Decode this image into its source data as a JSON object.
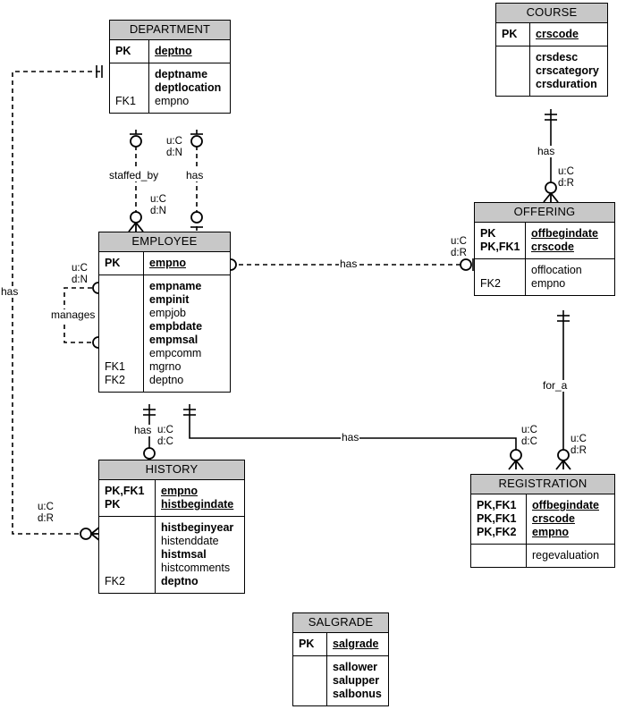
{
  "diagram": {
    "title": "ER Diagram",
    "type": "entity-relationship",
    "accent_header_color": "#c8c8c8",
    "line_color": "#000000"
  },
  "entities": {
    "department": {
      "name": "DEPARTMENT",
      "key_rows": [
        {
          "key": "PK",
          "attr": "deptno",
          "style": "pk"
        }
      ],
      "attr_rows": [
        {
          "key": "",
          "attr": "deptname",
          "style": "bold"
        },
        {
          "key": "",
          "attr": "deptlocation",
          "style": "bold"
        },
        {
          "key": "FK1",
          "attr": "empno",
          "style": "plain"
        }
      ]
    },
    "course": {
      "name": "COURSE",
      "key_rows": [
        {
          "key": "PK",
          "attr": "crscode",
          "style": "pk"
        }
      ],
      "attr_rows": [
        {
          "key": "",
          "attr": "crsdesc",
          "style": "bold"
        },
        {
          "key": "",
          "attr": "crscategory",
          "style": "bold"
        },
        {
          "key": "",
          "attr": "crsduration",
          "style": "bold"
        }
      ]
    },
    "employee": {
      "name": "EMPLOYEE",
      "key_rows": [
        {
          "key": "PK",
          "attr": "empno",
          "style": "pk"
        }
      ],
      "attr_rows": [
        {
          "key": "",
          "attr": "empname",
          "style": "bold"
        },
        {
          "key": "",
          "attr": "empinit",
          "style": "bold"
        },
        {
          "key": "",
          "attr": "empjob",
          "style": "plain"
        },
        {
          "key": "",
          "attr": "empbdate",
          "style": "bold"
        },
        {
          "key": "",
          "attr": "empmsal",
          "style": "bold"
        },
        {
          "key": "",
          "attr": "empcomm",
          "style": "plain"
        },
        {
          "key": "FK1",
          "attr": "mgrno",
          "style": "plain"
        },
        {
          "key": "FK2",
          "attr": "deptno",
          "style": "plain"
        }
      ]
    },
    "offering": {
      "name": "OFFERING",
      "key_rows": [
        {
          "key": "PK",
          "attr": "offbegindate",
          "style": "pk"
        },
        {
          "key": "PK,FK1",
          "attr": "crscode",
          "style": "pk"
        }
      ],
      "attr_rows": [
        {
          "key": "",
          "attr": "offlocation",
          "style": "plain"
        },
        {
          "key": "FK2",
          "attr": "empno",
          "style": "plain"
        }
      ]
    },
    "history": {
      "name": "HISTORY",
      "key_rows": [
        {
          "key": "PK,FK1",
          "attr": "empno",
          "style": "pk"
        },
        {
          "key": "PK",
          "attr": "histbegindate",
          "style": "pk"
        }
      ],
      "attr_rows": [
        {
          "key": "",
          "attr": "histbeginyear",
          "style": "bold"
        },
        {
          "key": "",
          "attr": "histenddate",
          "style": "plain"
        },
        {
          "key": "",
          "attr": "histmsal",
          "style": "bold"
        },
        {
          "key": "",
          "attr": "histcomments",
          "style": "plain"
        },
        {
          "key": "FK2",
          "attr": "deptno",
          "style": "bold"
        }
      ]
    },
    "registration": {
      "name": "REGISTRATION",
      "key_rows": [
        {
          "key": "PK,FK1",
          "attr": "offbegindate",
          "style": "pk"
        },
        {
          "key": "PK,FK1",
          "attr": "crscode",
          "style": "pk"
        },
        {
          "key": "PK,FK2",
          "attr": "empno",
          "style": "pk"
        }
      ],
      "attr_rows": [
        {
          "key": "",
          "attr": "regevaluation",
          "style": "plain"
        }
      ]
    },
    "salgrade": {
      "name": "SALGRADE",
      "key_rows": [
        {
          "key": "PK",
          "attr": "salgrade",
          "style": "pk"
        }
      ],
      "attr_rows": [
        {
          "key": "",
          "attr": "sallower",
          "style": "bold"
        },
        {
          "key": "",
          "attr": "salupper",
          "style": "bold"
        },
        {
          "key": "",
          "attr": "salbonus",
          "style": "bold"
        }
      ]
    }
  },
  "relationships": [
    {
      "id": "dept-emp-staffed-by",
      "label": "staffed_by",
      "from": "DEPARTMENT",
      "to": "EMPLOYEE",
      "line": "dashed",
      "rules": "u:C\nd:N",
      "rule_update": "u:C",
      "rule_delete": "d:N"
    },
    {
      "id": "dept-emp-has",
      "label": "has",
      "from": "DEPARTMENT",
      "to": "EMPLOYEE",
      "line": "dashed",
      "rule_update": "u:C",
      "rule_delete": "d:N"
    },
    {
      "id": "emp-manages",
      "label": "manages",
      "from": "EMPLOYEE",
      "to": "EMPLOYEE",
      "line": "dashed",
      "rule_update": "u:C",
      "rule_delete": "d:N"
    },
    {
      "id": "emp-offering-has",
      "label": "has",
      "from": "EMPLOYEE",
      "to": "OFFERING",
      "line": "dashed",
      "rule_update": "u:C",
      "rule_delete": "d:R"
    },
    {
      "id": "course-offering-has",
      "label": "has",
      "from": "COURSE",
      "to": "OFFERING",
      "line": "solid",
      "rule_update": "u:C",
      "rule_delete": "d:R"
    },
    {
      "id": "offering-registration-for-a",
      "label": "for_a",
      "from": "OFFERING",
      "to": "REGISTRATION",
      "line": "solid",
      "rule_update": "u:C",
      "rule_delete": "d:R"
    },
    {
      "id": "emp-history-has",
      "label": "has",
      "from": "EMPLOYEE",
      "to": "HISTORY",
      "line": "solid",
      "rule_update": "u:C",
      "rule_delete": "d:C"
    },
    {
      "id": "emp-registration-has",
      "label": "has",
      "from": "EMPLOYEE",
      "to": "REGISTRATION",
      "line": "solid",
      "rule_update": "u:C",
      "rule_delete": "d:C"
    },
    {
      "id": "dept-history-has",
      "label": "has",
      "from": "DEPARTMENT",
      "to": "HISTORY",
      "line": "dashed",
      "rule_update": "u:C",
      "rule_delete": "d:R"
    }
  ],
  "edge_labels": {
    "staffed_by": "staffed_by",
    "has_dept_emp": "has",
    "manages": "manages",
    "has_emp_offering": "has",
    "has_course_offering": "has",
    "for_a": "for_a",
    "has_emp_history": "has",
    "has_emp_registration": "has",
    "has_dept_history": "has"
  },
  "cardinality": {
    "uc_dn_1": "u:C",
    "uc_dn_1b": "d:N",
    "uc_dn_2": "u:C",
    "uc_dn_2b": "d:N",
    "uc_dn_3": "u:C",
    "uc_dn_3b": "d:N",
    "uc_dr_emp_off": "u:C",
    "uc_dr_emp_offb": "d:R",
    "uc_dr_course": "u:C",
    "uc_dr_courseb": "d:R",
    "uc_dr_offreg": "u:C",
    "uc_dr_offregb": "d:R",
    "uc_dc_hist": "u:C",
    "uc_dc_histb": "d:C",
    "uc_dc_reg": "u:C",
    "uc_dc_regb": "d:C",
    "uc_dr_depthist": "u:C",
    "uc_dr_depthistb": "d:R"
  }
}
